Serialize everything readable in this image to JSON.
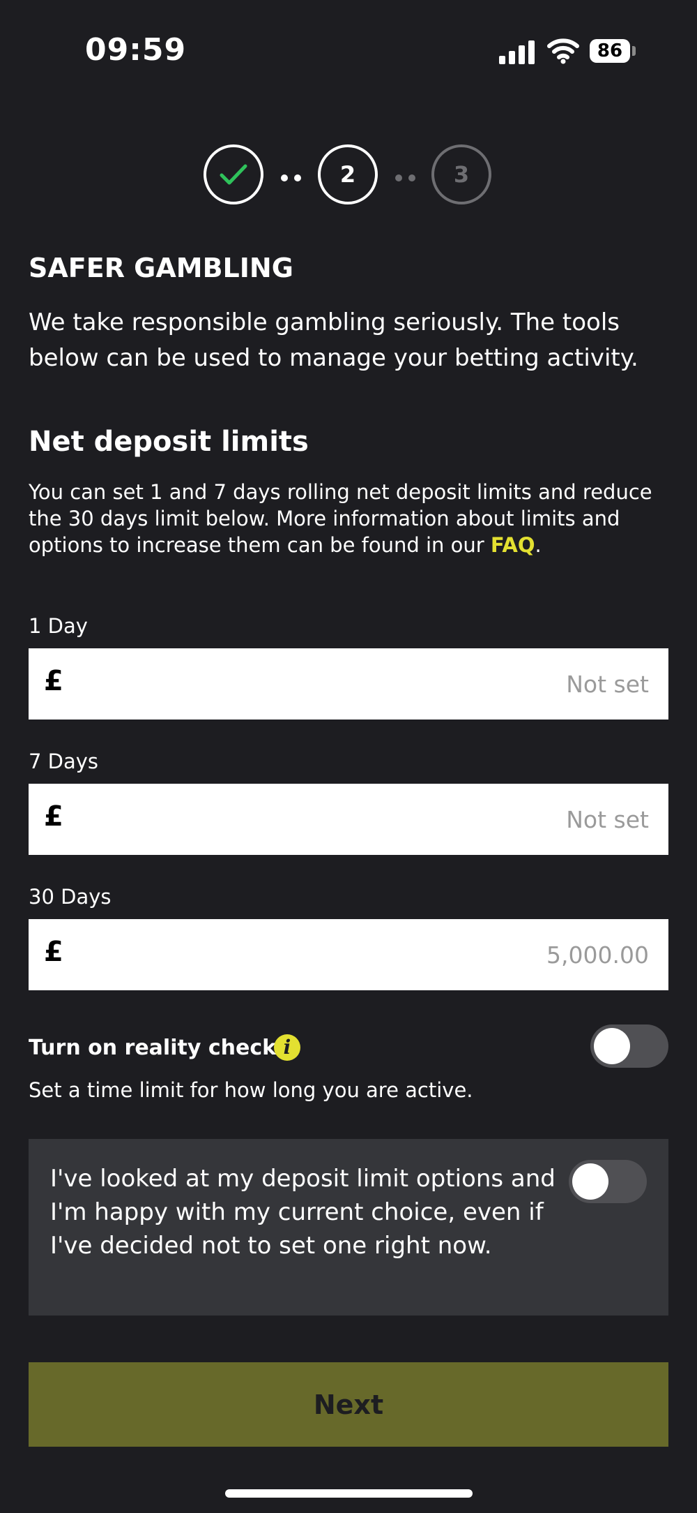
{
  "status_bar": {
    "time": "09:59",
    "battery": "86"
  },
  "stepper": {
    "step2": "2",
    "step3": "3"
  },
  "page": {
    "title": "SAFER GAMBLING",
    "intro": "We take responsible gambling seriously. The tools below can be used to manage your betting activity."
  },
  "deposit": {
    "heading": "Net deposit limits",
    "description": "You can set 1 and 7 days rolling net deposit limits and reduce the 30 days limit below. More information about limits and options to increase them can be found in our ",
    "faq_link": "FAQ",
    "period": ".",
    "currency": "£",
    "fields": [
      {
        "label": "1 Day",
        "placeholder": "Not set"
      },
      {
        "label": "7 Days",
        "placeholder": "Not set"
      },
      {
        "label": "30 Days",
        "placeholder": "5,000.00"
      }
    ]
  },
  "reality_check": {
    "label": "Turn on reality check",
    "info_icon_text": "i",
    "description": "Set a time limit for how long you are active.",
    "enabled": false
  },
  "confirmation": {
    "text": "I've looked at my deposit limit options and I'm happy with my current choice, even if I've decided not to set one right now.",
    "enabled": false
  },
  "next_button": "Next",
  "colors": {
    "background": "#1d1d21",
    "accent": "#e3e031",
    "next_button": "#67692a",
    "panel": "#35363a",
    "check": "#2fc25b"
  }
}
